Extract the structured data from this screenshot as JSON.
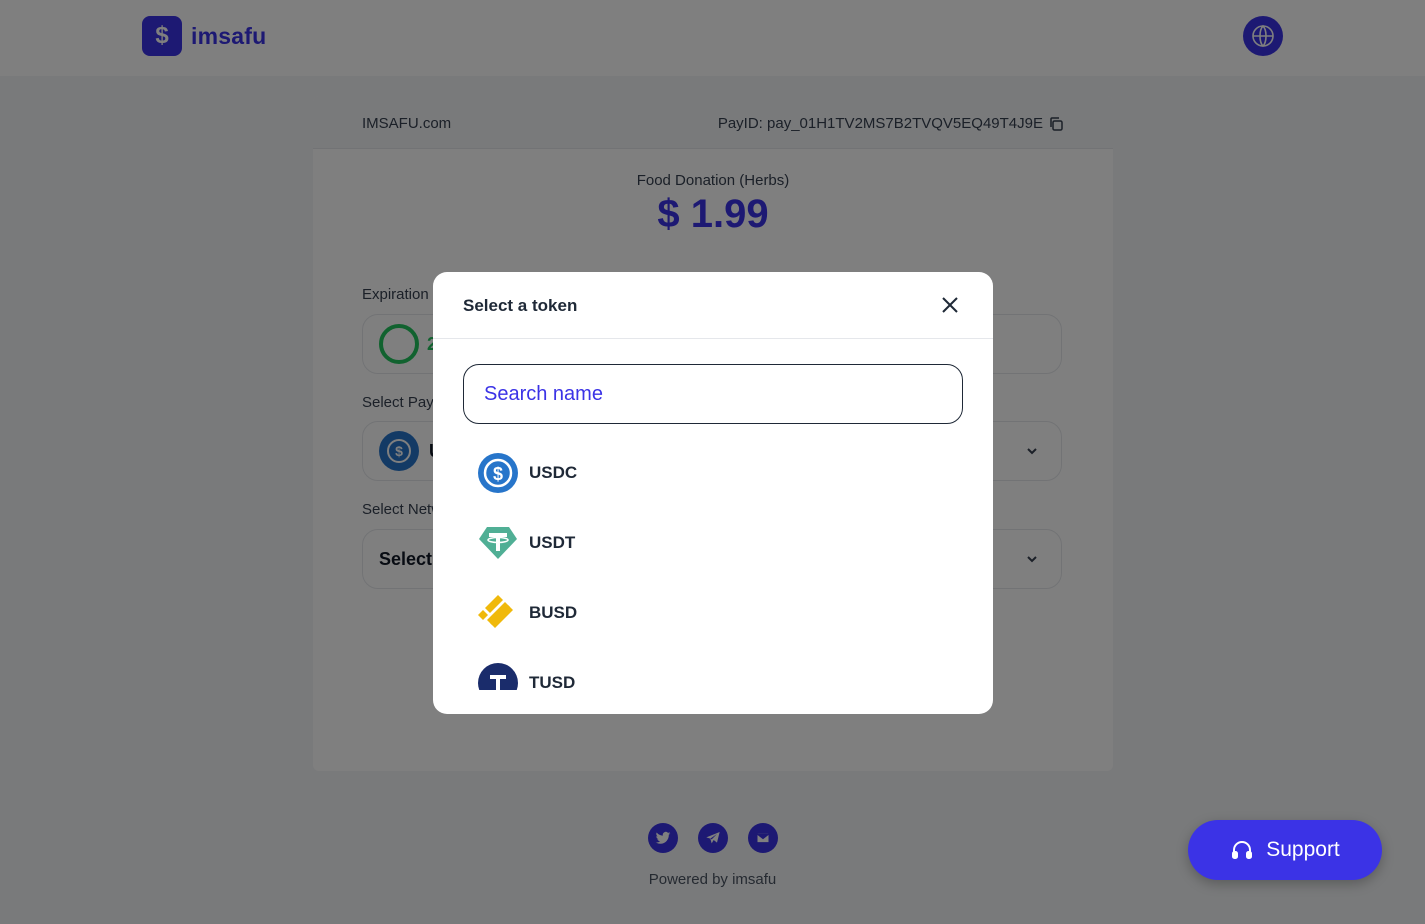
{
  "header": {
    "logo_mark": "$",
    "logo_text": "imsafu"
  },
  "card": {
    "site": "IMSAFU.com",
    "pay_id": "PayID: pay_01H1TV2MS7B2TVQV5EQ49T4J9E",
    "product": "Food Donation (Herbs)",
    "price": "$ 1.99",
    "expiration_label": "Expiration",
    "timer_fragment": "2",
    "pay_label": "Select Pay",
    "pay_value_fragment": "U",
    "network_label": "Select Netw",
    "network_value_fragment": "Select"
  },
  "footer": {
    "powered": "Powered by imsafu"
  },
  "support": {
    "label": "Support"
  },
  "modal": {
    "title": "Select a token",
    "search_placeholder": "Search name",
    "tokens": [
      {
        "name": "USDC",
        "icon": "usdc-icon",
        "color": "#2775ca"
      },
      {
        "name": "USDT",
        "icon": "usdt-icon",
        "color": "#50af95"
      },
      {
        "name": "BUSD",
        "icon": "busd-icon",
        "color": "#f0b90b"
      },
      {
        "name": "TUSD",
        "icon": "tusd-icon",
        "color": "#1a2c6b"
      }
    ]
  },
  "colors": {
    "brand": "#3b33e6",
    "timer": "#22c55e"
  }
}
